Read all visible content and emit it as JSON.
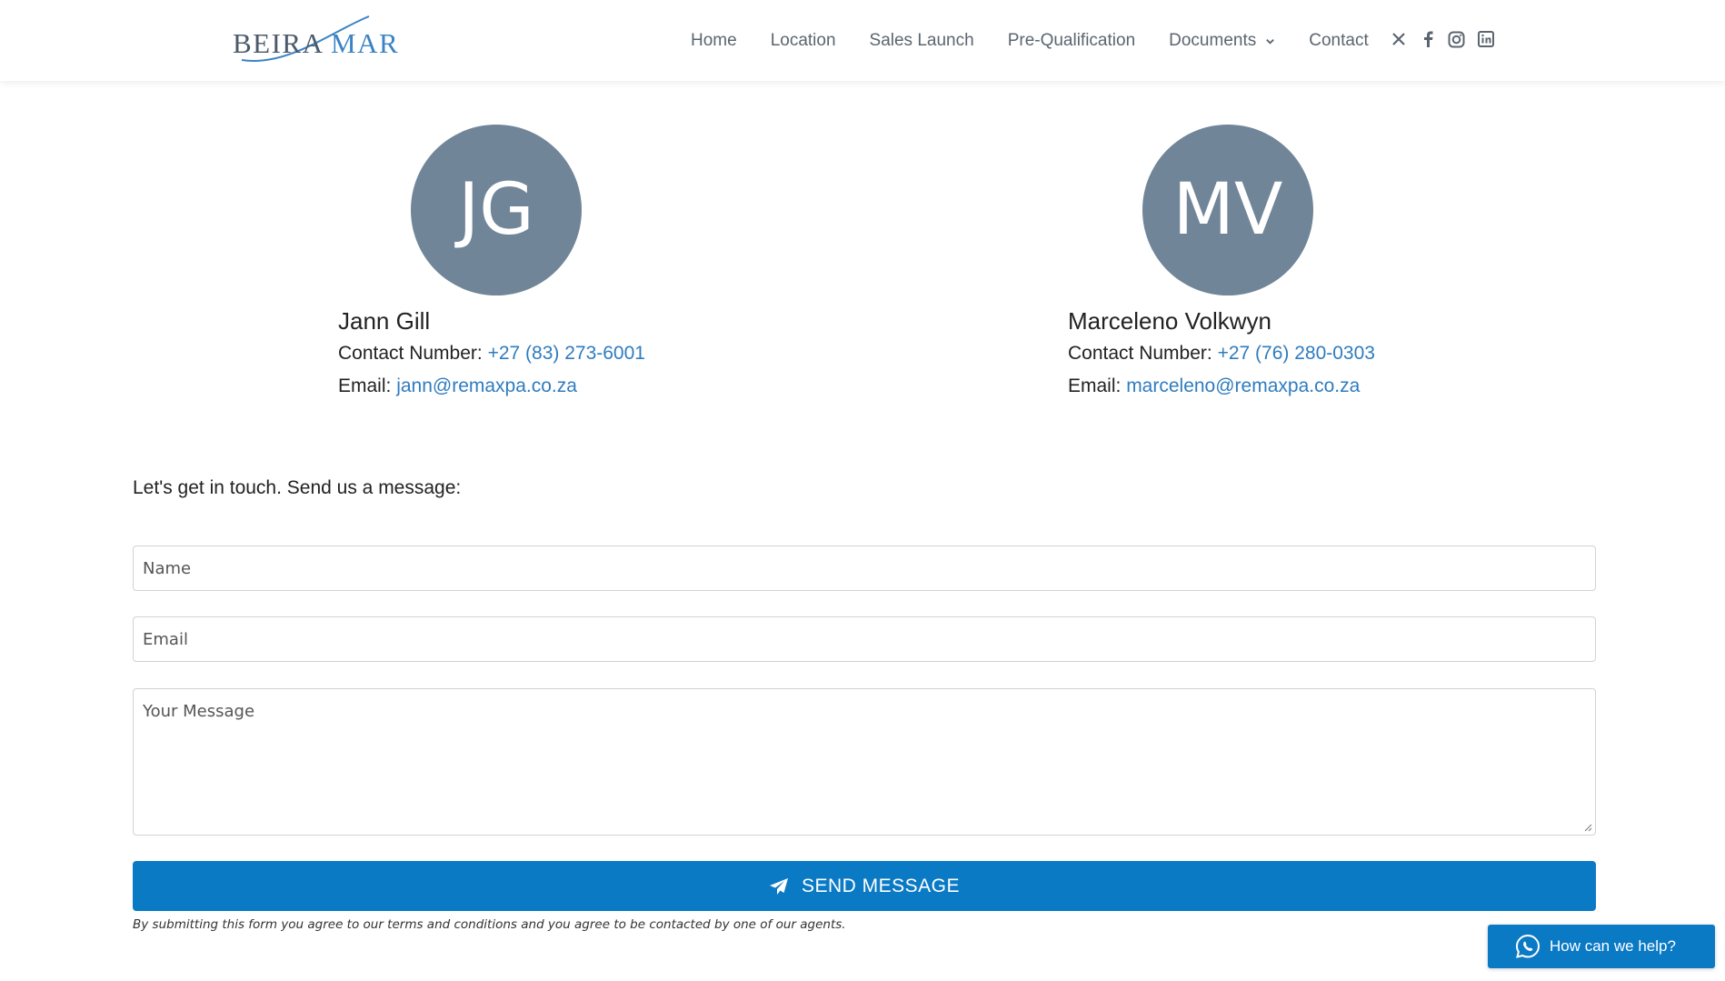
{
  "header": {
    "logo": {
      "part1": "BEIRA ",
      "part2": "MAR"
    },
    "nav": [
      {
        "label": "Home"
      },
      {
        "label": "Location"
      },
      {
        "label": "Sales Launch"
      },
      {
        "label": "Pre-Qualification"
      },
      {
        "label": "Documents"
      },
      {
        "label": "Contact"
      }
    ],
    "social_icons": [
      "x-icon",
      "facebook-icon",
      "instagram-icon",
      "linkedin-icon"
    ]
  },
  "agents": [
    {
      "initials": "JG",
      "name": "Jann Gill",
      "phone_label": "Contact Number: ",
      "phone": "+27 (83) 273-6001",
      "email_label": "Email: ",
      "email": "jann@remaxpa.co.za"
    },
    {
      "initials": "MV",
      "name": "Marceleno Volkwyn",
      "phone_label": "Contact Number: ",
      "phone": "+27 (76) 280-0303",
      "email_label": "Email: ",
      "email": "marceleno@remaxpa.co.za"
    }
  ],
  "form": {
    "intro": "Let's get in touch. Send us a message:",
    "name_placeholder": "Name",
    "email_placeholder": "Email",
    "message_placeholder": "Your Message",
    "submit_label": "SEND MESSAGE",
    "disclaimer": "By submitting this form you agree to our terms and conditions and you agree to be contacted by one of our agents."
  },
  "chat_widget": {
    "label": "How can we help?"
  },
  "colors": {
    "accent": "#0b7ac5",
    "link": "#2f7cbf",
    "avatar_bg": "#718599",
    "nav_text": "#5b6570"
  }
}
